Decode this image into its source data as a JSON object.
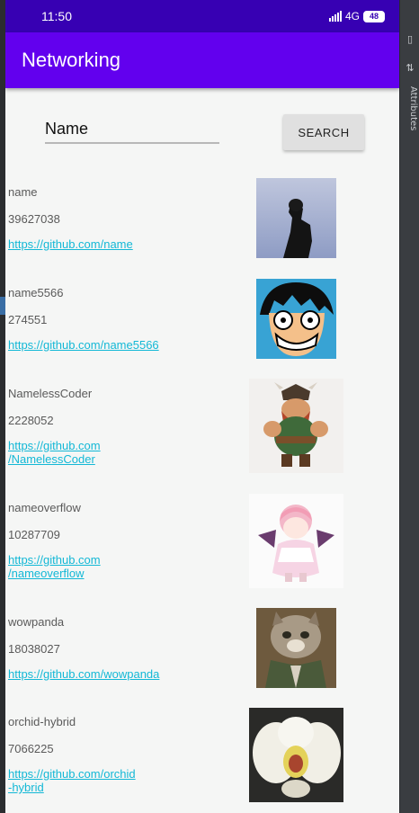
{
  "status_bar": {
    "time": "11:50",
    "network": "4G",
    "battery": "48"
  },
  "app_bar": {
    "title": "Networking"
  },
  "search": {
    "value": "Name",
    "button_label": "SEARCH"
  },
  "ide": {
    "side_panel_label": "Attributes"
  },
  "results": [
    {
      "name": "name",
      "id": "39627038",
      "link": "https://github.com/name",
      "avatar_icon": "silhouette-photo"
    },
    {
      "name": "name5566",
      "id": "274551",
      "link": "https://github.com/name5566",
      "avatar_icon": "anime-face"
    },
    {
      "name": "NamelessCoder",
      "id": "2228052",
      "link": "https://github.com\n/NamelessCoder",
      "avatar_icon": "viking-character"
    },
    {
      "name": "nameoverflow",
      "id": "10287709",
      "link": "https://github.com\n/nameoverflow",
      "avatar_icon": "anime-girl"
    },
    {
      "name": "wowpanda",
      "id": "18038027",
      "link": "https://github.com/wowpanda",
      "avatar_icon": "cat-in-jacket"
    },
    {
      "name": "orchid-hybrid",
      "id": "7066225",
      "link": "https://github.com/orchid\n-hybrid",
      "avatar_icon": "orchid-flower"
    }
  ],
  "colors": {
    "status_bar": "#3700b3",
    "app_bar": "#6200ee",
    "link": "#13b8d6",
    "background": "#f5f6f5"
  }
}
